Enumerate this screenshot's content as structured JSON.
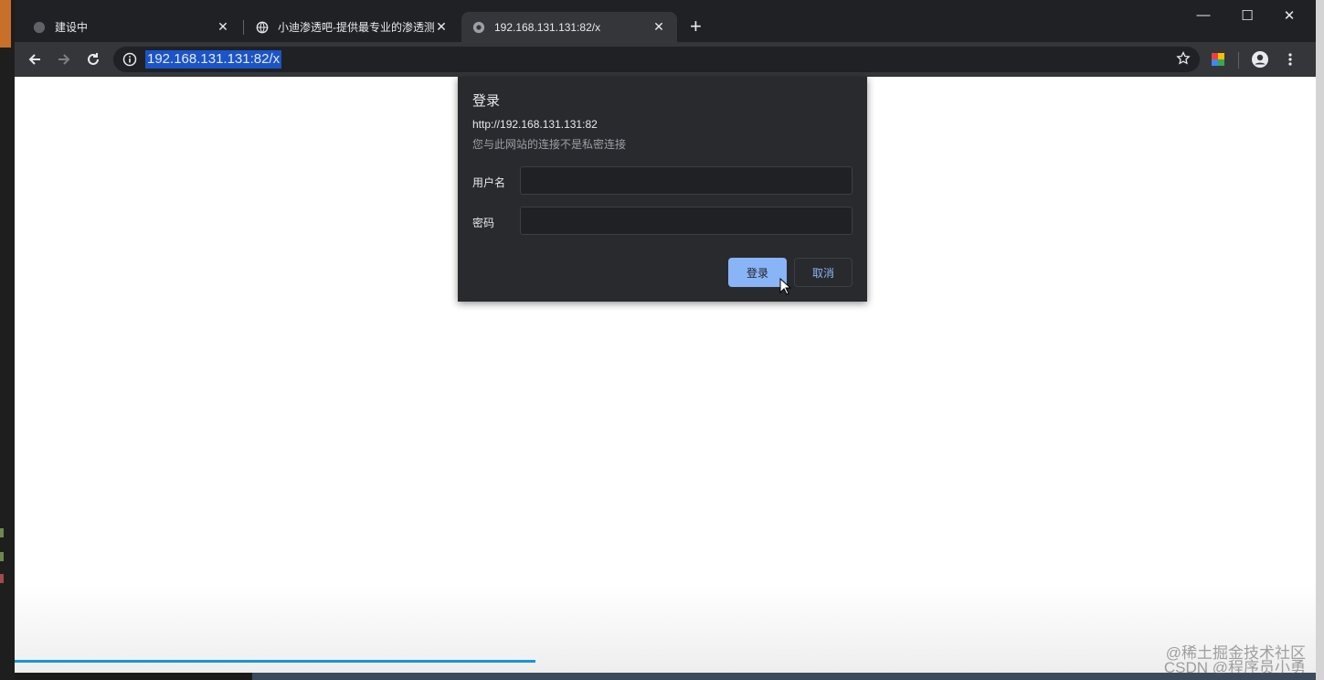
{
  "tabs": [
    {
      "title": "建设中",
      "icon": "globe-icon"
    },
    {
      "title": "小迪渗透吧-提供最专业的渗透测",
      "icon": "globe-icon"
    },
    {
      "title": "192.168.131.131:82/x",
      "icon": "globe-icon",
      "active": true
    }
  ],
  "address_bar": {
    "url": "192.168.131.131:82/x"
  },
  "auth_dialog": {
    "title": "登录",
    "origin": "http://192.168.131.131:82",
    "warning": "您与此网站的连接不是私密连接",
    "username_label": "用户名",
    "password_label": "密码",
    "username_value": "",
    "password_value": "",
    "login_button": "登录",
    "cancel_button": "取消"
  },
  "page_load_progress": 0.4,
  "watermarks": [
    "@稀土掘金技术社区",
    "CSDN @程序员小勇"
  ],
  "colors": {
    "accent": "#8ab4f8",
    "url_highlight": "#1a54c8",
    "progress": "#1a94d8"
  }
}
